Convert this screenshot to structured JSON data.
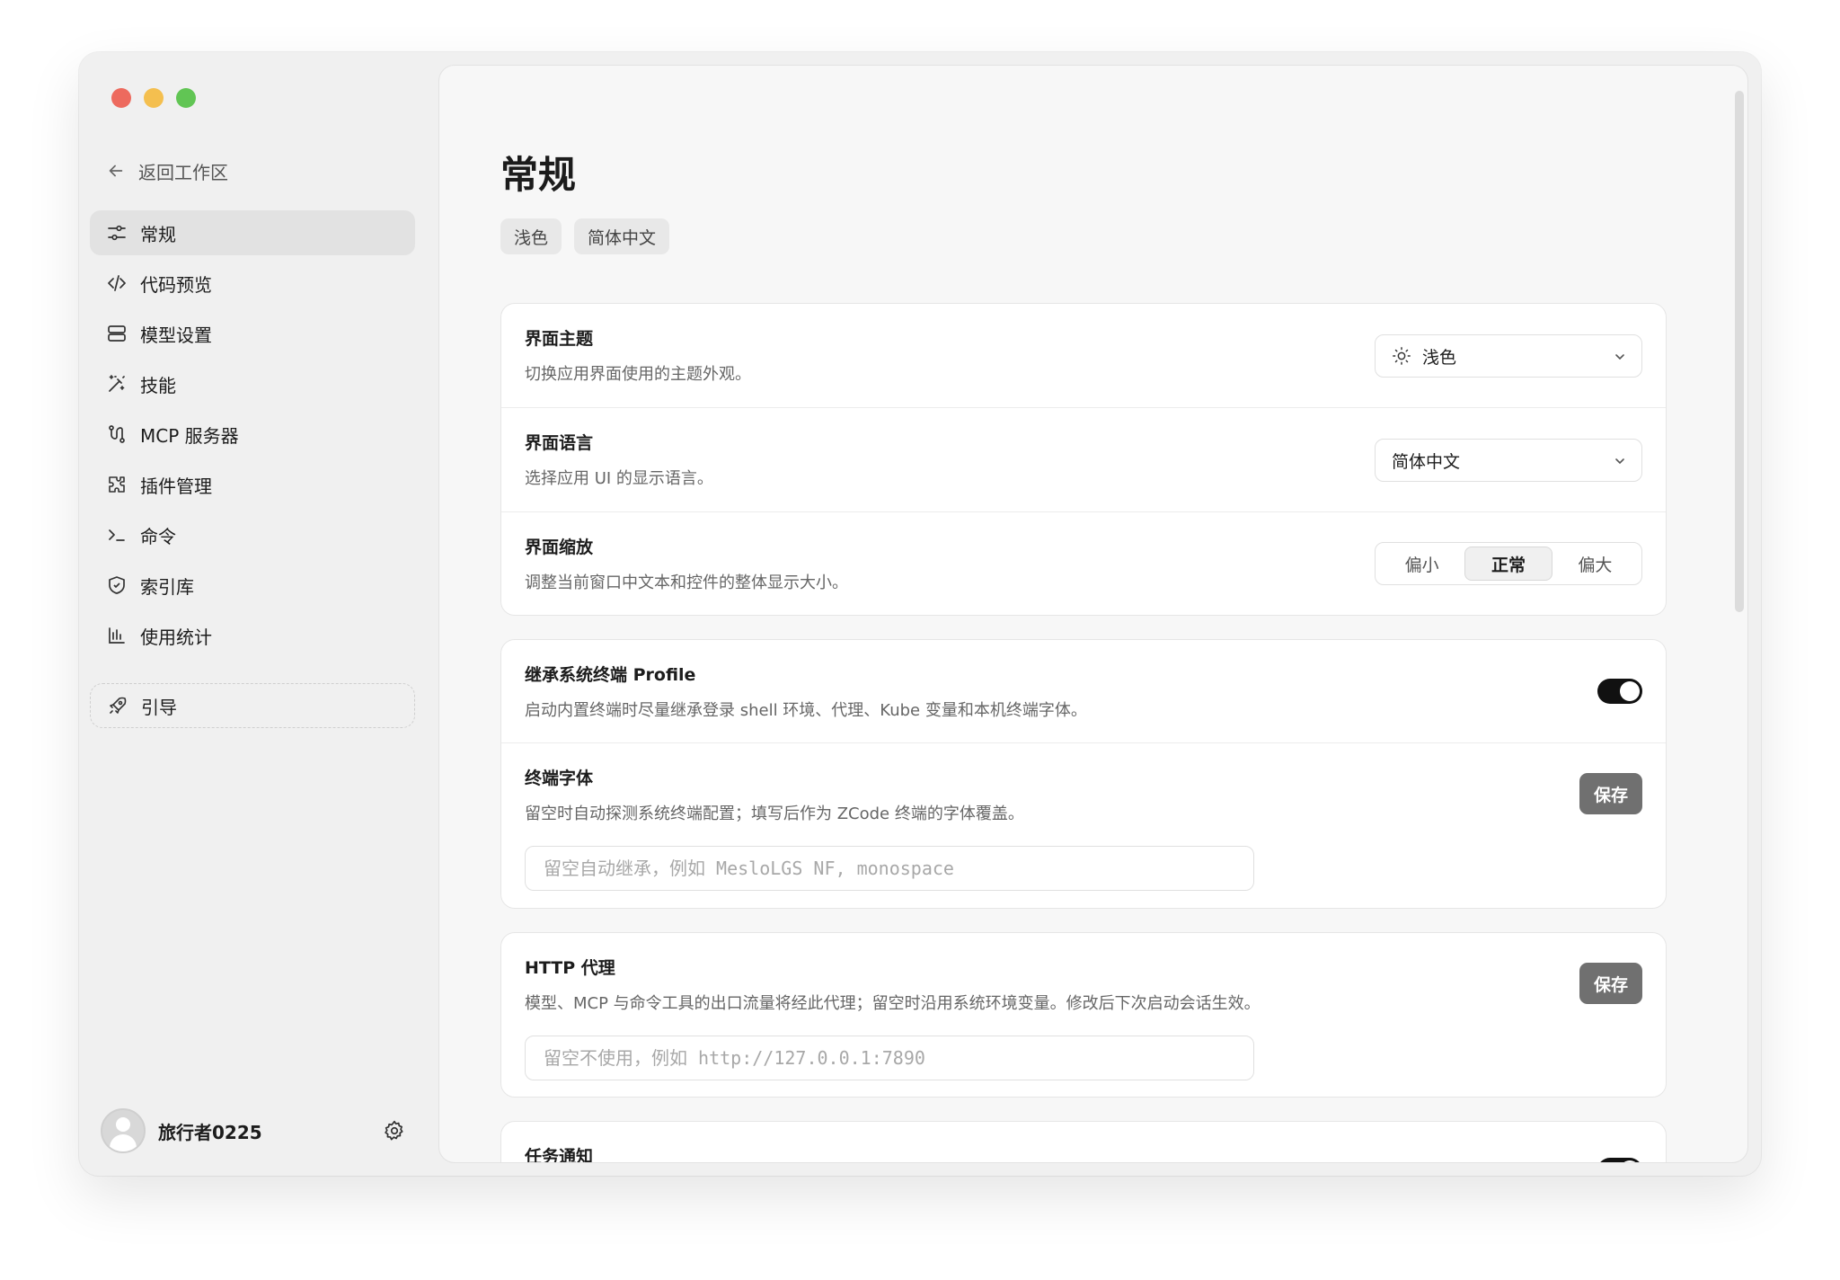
{
  "sidebar": {
    "back_label": "返回工作区",
    "items": [
      {
        "label": "常规",
        "icon": "sliders-icon",
        "active": true
      },
      {
        "label": "代码预览",
        "icon": "code-icon"
      },
      {
        "label": "模型设置",
        "icon": "server-icon"
      },
      {
        "label": "技能",
        "icon": "magic-wand-icon"
      },
      {
        "label": "MCP 服务器",
        "icon": "route-icon"
      },
      {
        "label": "插件管理",
        "icon": "puzzle-icon"
      },
      {
        "label": "命令",
        "icon": "terminal-icon"
      },
      {
        "label": "索引库",
        "icon": "shield-icon"
      },
      {
        "label": "使用统计",
        "icon": "bar-chart-icon"
      }
    ],
    "guide_label": "引导",
    "user": {
      "name": "旅行者0225"
    }
  },
  "main": {
    "title": "常规",
    "chips": [
      "浅色",
      "简体中文"
    ],
    "appearance": {
      "theme": {
        "title": "界面主题",
        "desc": "切换应用界面使用的主题外观。",
        "value": "浅色"
      },
      "language": {
        "title": "界面语言",
        "desc": "选择应用 UI 的显示语言。",
        "value": "简体中文"
      },
      "scale": {
        "title": "界面缩放",
        "desc": "调整当前窗口中文本和控件的整体显示大小。",
        "options": [
          "偏小",
          "正常",
          "偏大"
        ],
        "selected": "正常"
      }
    },
    "terminal": {
      "profile": {
        "title": "继承系统终端 Profile",
        "desc": "启动内置终端时尽量继承登录 shell 环境、代理、Kube 变量和本机终端字体。",
        "enabled": true
      },
      "font": {
        "title": "终端字体",
        "desc": "留空时自动探测系统终端配置；填写后作为 ZCode 终端的字体覆盖。",
        "placeholder": "留空自动继承，例如 MesloLGS NF, monospace",
        "value": "",
        "save_label": "保存"
      }
    },
    "proxy": {
      "title": "HTTP 代理",
      "desc": "模型、MCP 与命令工具的出口流量将经此代理；留空时沿用系统环境变量。修改后下次启动会话生效。",
      "placeholder": "留空不使用，例如 http://127.0.0.1:7890",
      "value": "",
      "save_label": "保存"
    },
    "notify": {
      "title": "任务通知"
    }
  }
}
